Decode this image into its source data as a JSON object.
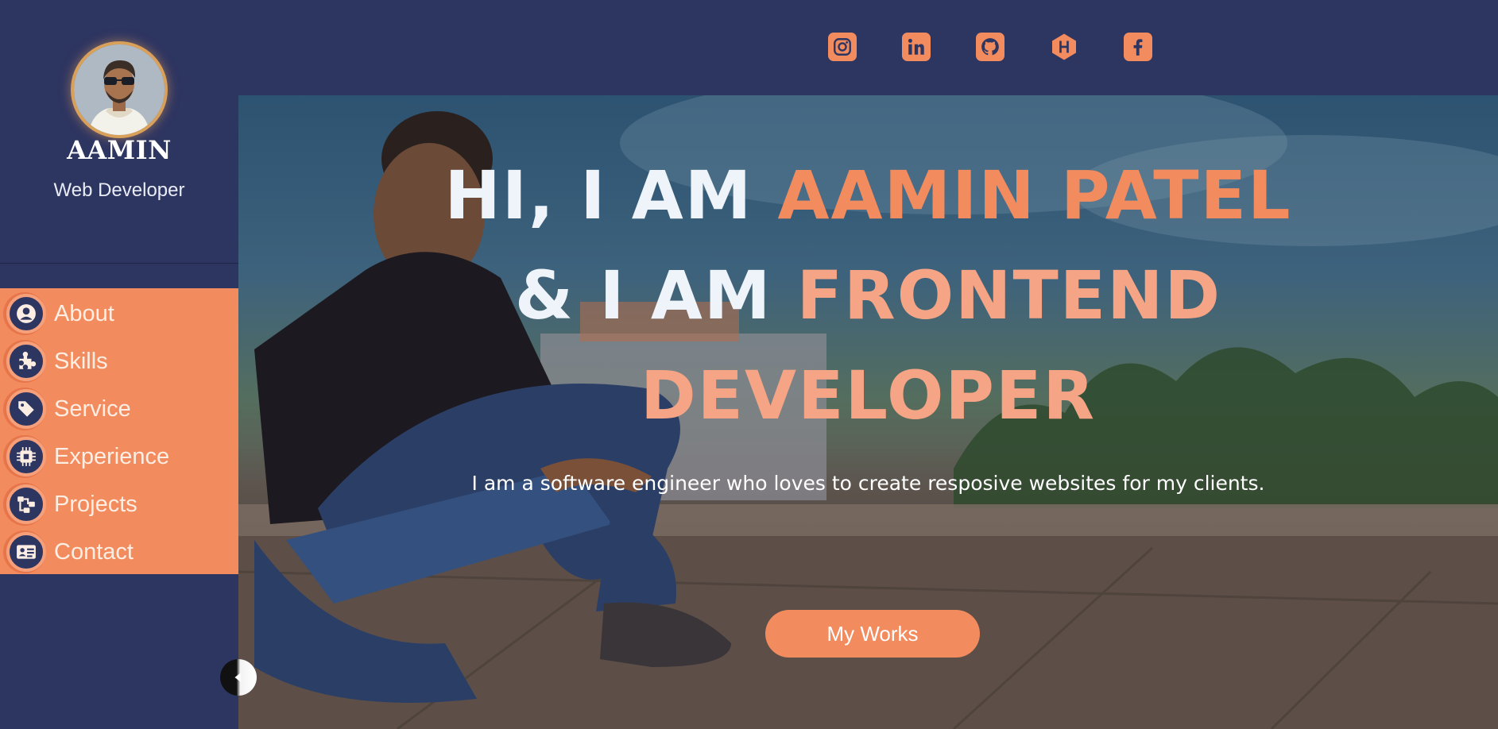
{
  "profile": {
    "name": "AAMIN",
    "role": "Web Developer"
  },
  "nav": {
    "items": [
      {
        "label": "About",
        "icon": "user-circle-icon"
      },
      {
        "label": "Skills",
        "icon": "puzzle-icon"
      },
      {
        "label": "Service",
        "icon": "tags-icon"
      },
      {
        "label": "Experience",
        "icon": "chip-icon"
      },
      {
        "label": "Projects",
        "icon": "project-diagram-icon"
      },
      {
        "label": "Contact",
        "icon": "id-card-icon"
      }
    ]
  },
  "social": [
    {
      "icon": "instagram-icon"
    },
    {
      "icon": "linkedin-icon"
    },
    {
      "icon": "github-icon"
    },
    {
      "icon": "hashnode-icon"
    },
    {
      "icon": "facebook-icon"
    }
  ],
  "hero": {
    "line1_white": "HI, I AM ",
    "line1_accent": "AAMIN PATEL",
    "line2_white": "& I AM ",
    "line2_accent": "FRONTEND",
    "line3_accent": "DEVELOPER",
    "subtitle": "I am a software engineer who loves to create resposive websites for my clients.",
    "button_label": "My Works"
  },
  "colors": {
    "background": "#2d3561",
    "accent": "#f28b5e",
    "headline_white": "#eef4fa"
  }
}
